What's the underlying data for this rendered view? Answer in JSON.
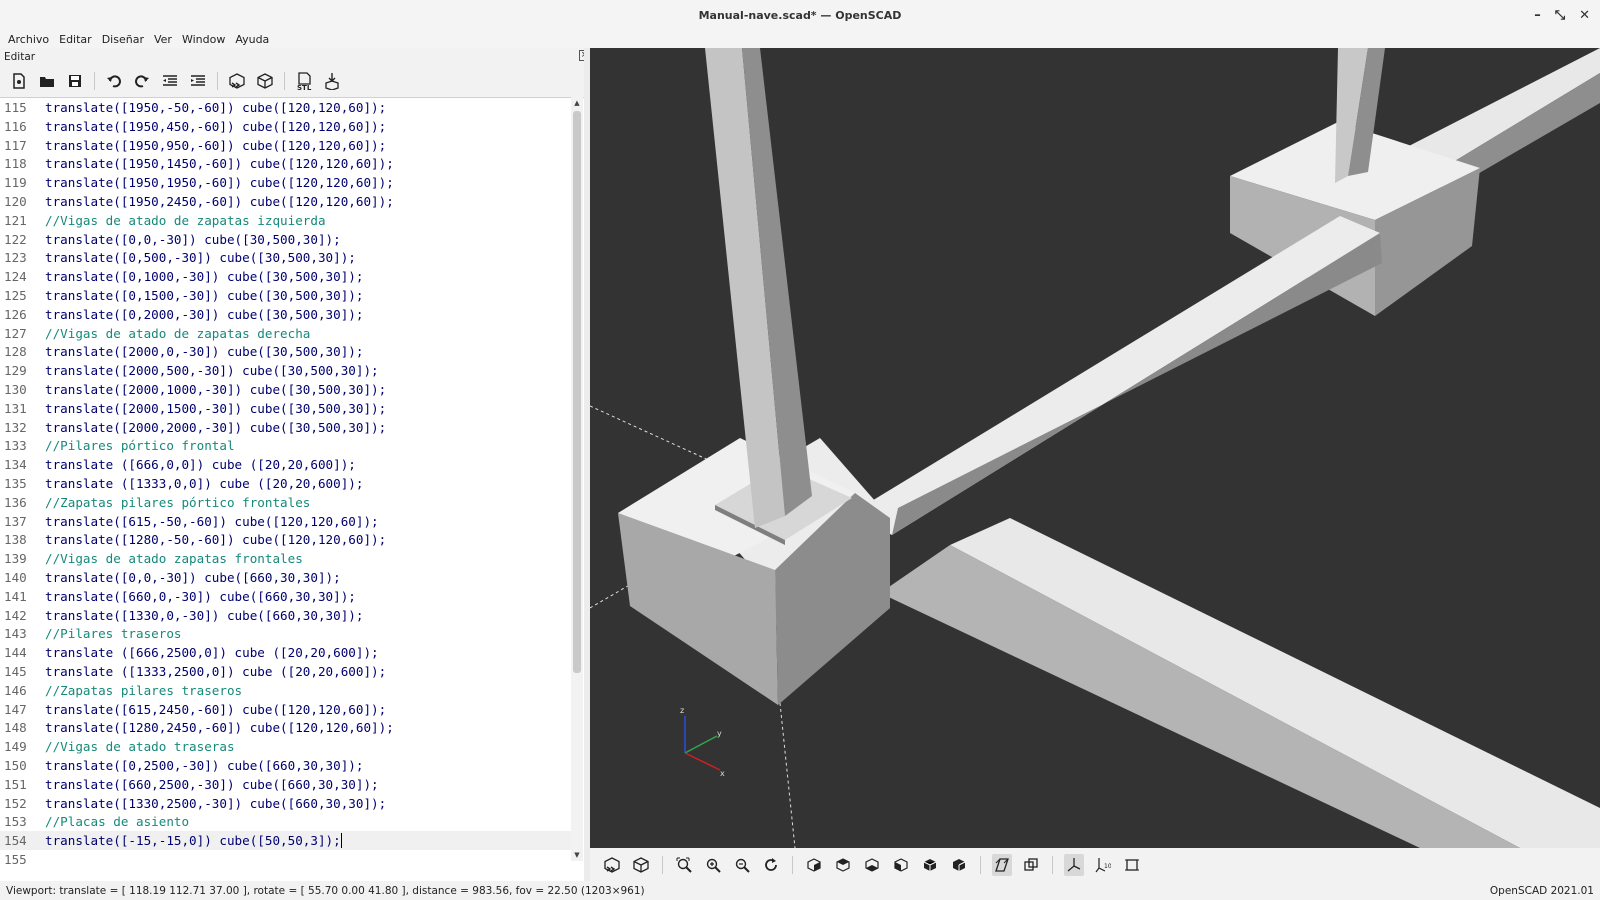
{
  "window": {
    "title": "Manual-nave.scad* — OpenSCAD"
  },
  "menu": [
    "Archivo",
    "Editar",
    "Diseñar",
    "Ver",
    "Window",
    "Ayuda"
  ],
  "editor": {
    "dock_title": "Editar",
    "lines": [
      {
        "n": "115",
        "text": "translate([1950,-50,-60]) cube([120,120,60]);"
      },
      {
        "n": "116",
        "text": "translate([1950,450,-60]) cube([120,120,60]);"
      },
      {
        "n": "117",
        "text": "translate([1950,950,-60]) cube([120,120,60]);"
      },
      {
        "n": "118",
        "text": "translate([1950,1450,-60]) cube([120,120,60]);"
      },
      {
        "n": "119",
        "text": "translate([1950,1950,-60]) cube([120,120,60]);"
      },
      {
        "n": "120",
        "text": "translate([1950,2450,-60]) cube([120,120,60]);"
      },
      {
        "n": "121",
        "text": "//Vigas de atado de zapatas izquierda",
        "comment": true
      },
      {
        "n": "122",
        "text": "translate([0,0,-30]) cube([30,500,30]);"
      },
      {
        "n": "123",
        "text": "translate([0,500,-30]) cube([30,500,30]);"
      },
      {
        "n": "124",
        "text": "translate([0,1000,-30]) cube([30,500,30]);"
      },
      {
        "n": "125",
        "text": "translate([0,1500,-30]) cube([30,500,30]);"
      },
      {
        "n": "126",
        "text": "translate([0,2000,-30]) cube([30,500,30]);"
      },
      {
        "n": "127",
        "text": "//Vigas de atado de zapatas derecha",
        "comment": true
      },
      {
        "n": "128",
        "text": "translate([2000,0,-30]) cube([30,500,30]);"
      },
      {
        "n": "129",
        "text": "translate([2000,500,-30]) cube([30,500,30]);"
      },
      {
        "n": "130",
        "text": "translate([2000,1000,-30]) cube([30,500,30]);"
      },
      {
        "n": "131",
        "text": "translate([2000,1500,-30]) cube([30,500,30]);"
      },
      {
        "n": "132",
        "text": "translate([2000,2000,-30]) cube([30,500,30]);"
      },
      {
        "n": "133",
        "text": "//Pilares pórtico frontal",
        "comment": true
      },
      {
        "n": "134",
        "text": "translate ([666,0,0]) cube ([20,20,600]);"
      },
      {
        "n": "135",
        "text": "translate ([1333,0,0]) cube ([20,20,600]);"
      },
      {
        "n": "136",
        "text": "//Zapatas pilares pórtico frontales",
        "comment": true
      },
      {
        "n": "137",
        "text": "translate([615,-50,-60]) cube([120,120,60]);"
      },
      {
        "n": "138",
        "text": "translate([1280,-50,-60]) cube([120,120,60]);"
      },
      {
        "n": "139",
        "text": "//Vigas de atado zapatas frontales",
        "comment": true
      },
      {
        "n": "140",
        "text": "translate([0,0,-30]) cube([660,30,30]);"
      },
      {
        "n": "141",
        "text": "translate([660,0,-30]) cube([660,30,30]);"
      },
      {
        "n": "142",
        "text": "translate([1330,0,-30]) cube([660,30,30]);"
      },
      {
        "n": "143",
        "text": "//Pilares traseros",
        "comment": true
      },
      {
        "n": "144",
        "text": "translate ([666,2500,0]) cube ([20,20,600]);"
      },
      {
        "n": "145",
        "text": "translate ([1333,2500,0]) cube ([20,20,600]);"
      },
      {
        "n": "146",
        "text": "//Zapatas pilares traseros",
        "comment": true
      },
      {
        "n": "147",
        "text": "translate([615,2450,-60]) cube([120,120,60]);"
      },
      {
        "n": "148",
        "text": "translate([1280,2450,-60]) cube([120,120,60]);"
      },
      {
        "n": "149",
        "text": "//Vigas de atado traseras",
        "comment": true
      },
      {
        "n": "150",
        "text": "translate([0,2500,-30]) cube([660,30,30]);"
      },
      {
        "n": "151",
        "text": "translate([660,2500,-30]) cube([660,30,30]);"
      },
      {
        "n": "152",
        "text": "translate([1330,2500,-30]) cube([660,30,30]);"
      },
      {
        "n": "153",
        "text": "//Placas de asiento",
        "comment": true
      },
      {
        "n": "154",
        "text": "translate([-15,-15,0]) cube([50,50,3]);",
        "current": true
      },
      {
        "n": "155",
        "text": ""
      }
    ]
  },
  "axes": {
    "x": "x",
    "y": "y",
    "z": "z"
  },
  "status": {
    "left": "Viewport: translate = [ 118.19 112.71 37.00 ], rotate = [ 55.70 0.00 41.80 ], distance = 983.56, fov = 22.50 (1203×961)",
    "right": "OpenSCAD 2021.01"
  },
  "colors": {
    "viewport_bg": "#333333",
    "code": "#00006f",
    "comment": "#16897a"
  },
  "editor_toolbar_icons": [
    "new-file-icon",
    "open-file-icon",
    "save-icon",
    "undo-icon",
    "redo-icon",
    "unindent-icon",
    "indent-icon",
    "preview-icon",
    "render-icon",
    "export-stl-icon",
    "send-to-print-icon"
  ],
  "view_toolbar_icons": [
    "preview-icon",
    "render-icon",
    "view-all-icon",
    "zoom-in-icon",
    "zoom-out-icon",
    "reset-view-icon",
    "view-right-icon",
    "view-top-icon",
    "view-bottom-icon",
    "view-left-icon",
    "view-front-icon",
    "view-back-icon",
    "perspective-icon",
    "orthogonal-icon",
    "show-axes-icon",
    "show-scale-icon",
    "show-edges-icon"
  ]
}
